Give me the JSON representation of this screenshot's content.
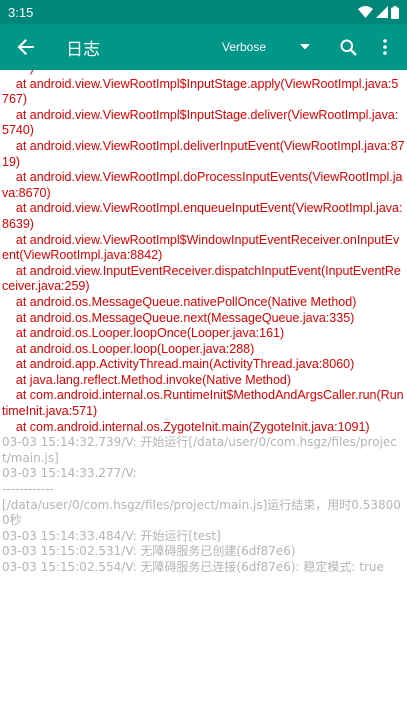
{
  "status_bar": {
    "time": "3:15"
  },
  "toolbar": {
    "title": "日志",
    "level": "Verbose",
    "icons": {
      "back": "arrow-back-icon",
      "dropdown": "caret-down-icon",
      "search": "search-icon",
      "more": "more-vert-icon"
    }
  },
  "colors": {
    "primary": "#009688",
    "status_bar": "#00877a",
    "error_text": "#e00000",
    "info_text": "#b4b4b4"
  },
  "log": {
    "lines": [
      {
        "level": "error",
        "text": "        )"
      },
      {
        "level": "error",
        "text": "    at android.view.ViewRootImpl$InputStage.apply(ViewRootImpl.java:5767)"
      },
      {
        "level": "error",
        "text": "    at android.view.ViewRootImpl$InputStage.deliver(ViewRootImpl.java:5740)"
      },
      {
        "level": "error",
        "text": "    at android.view.ViewRootImpl.deliverInputEvent(ViewRootImpl.java:8719)"
      },
      {
        "level": "error",
        "text": "    at android.view.ViewRootImpl.doProcessInputEvents(ViewRootImpl.java:8670)"
      },
      {
        "level": "error",
        "text": "    at android.view.ViewRootImpl.enqueueInputEvent(ViewRootImpl.java:8639)"
      },
      {
        "level": "error",
        "text": "    at android.view.ViewRootImpl$WindowInputEventReceiver.onInputEvent(ViewRootImpl.java:8842)"
      },
      {
        "level": "error",
        "text": "    at android.view.InputEventReceiver.dispatchInputEvent(InputEventReceiver.java:259)"
      },
      {
        "level": "error",
        "text": "    at android.os.MessageQueue.nativePollOnce(Native Method)"
      },
      {
        "level": "error",
        "text": "    at android.os.MessageQueue.next(MessageQueue.java:335)"
      },
      {
        "level": "error",
        "text": "    at android.os.Looper.loopOnce(Looper.java:161)"
      },
      {
        "level": "error",
        "text": "    at android.os.Looper.loop(Looper.java:288)"
      },
      {
        "level": "error",
        "text": "    at android.app.ActivityThread.main(ActivityThread.java:8060)"
      },
      {
        "level": "error",
        "text": "    at java.lang.reflect.Method.invoke(Native Method)"
      },
      {
        "level": "error",
        "text": "    at com.android.internal.os.RuntimeInit$MethodAndArgsCaller.run(RuntimeInit.java:571)"
      },
      {
        "level": "error",
        "text": "    at com.android.internal.os.ZygoteInit.main(ZygoteInit.java:1091)"
      },
      {
        "level": "info",
        "text": "03-03 15:14:32.739/V: 开始运行[/data/user/0/com.hsgz/files/project/main.js]"
      },
      {
        "level": "info",
        "text": "03-03 15:14:33.277/V:\n------------\n[/data/user/0/com.hsgz/files/project/main.js]运行结束，用时0.538000秒"
      },
      {
        "level": "info",
        "text": "03-03 15:14:33.484/V: 开始运行[test]"
      },
      {
        "level": "info",
        "text": "03-03 15:15:02.531/V: 无障碍服务已创建(6df87e6)"
      },
      {
        "level": "info",
        "text": "03-03 15:15:02.554/V: 无障碍服务已连接(6df87e6): 稳定模式: true"
      }
    ]
  }
}
